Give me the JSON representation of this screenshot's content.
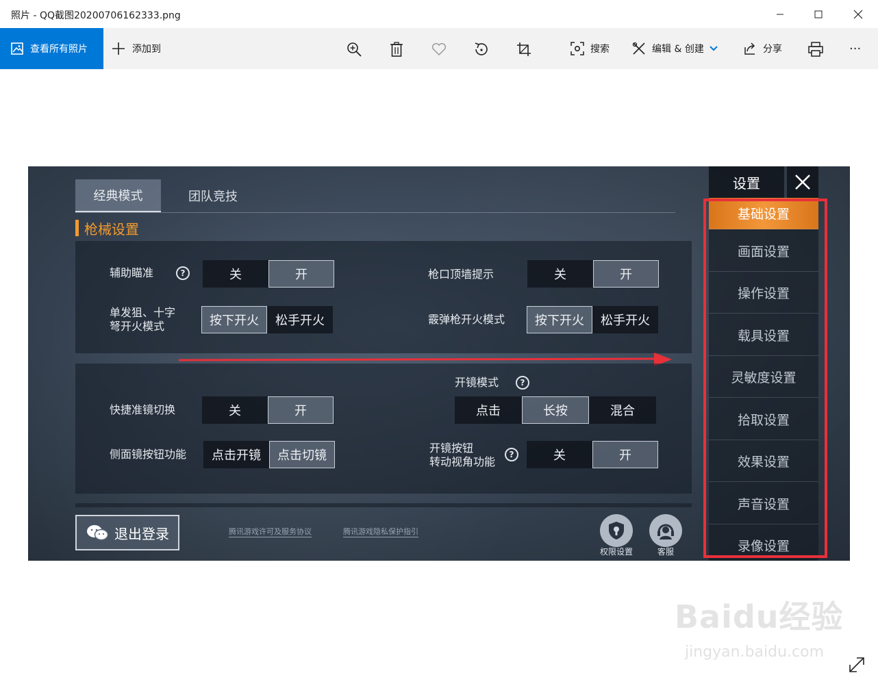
{
  "window": {
    "title": "照片 - QQ截图20200706162333.png"
  },
  "toolbar": {
    "view_all": "查看所有照片",
    "add_to": "添加到",
    "search": "搜索",
    "edit_create": "编辑 & 创建",
    "share": "分享",
    "more": "···"
  },
  "game": {
    "tabs": [
      "经典模式",
      "团队竞技"
    ],
    "section_title": "枪械设置",
    "aim_assist": {
      "label": "辅助瞄准",
      "options": [
        "关",
        "开"
      ],
      "selected": 1
    },
    "muzzle_hint": {
      "label": "枪口顶墙提示",
      "options": [
        "关",
        "开"
      ],
      "selected": 1
    },
    "sniper_fire": {
      "label_line1": "单发狙、十字",
      "label_line2": "弩开火模式",
      "options": [
        "按下开火",
        "松手开火"
      ],
      "selected": 0
    },
    "shotgun_fire": {
      "label": "霰弹枪开火模式",
      "options": [
        "按下开火",
        "松手开火"
      ],
      "selected": 0
    },
    "scope_mode": {
      "label": "开镜模式",
      "options": [
        "点击",
        "长按",
        "混合"
      ],
      "selected": 1
    },
    "quick_scope": {
      "label": "快捷准镜切换",
      "options": [
        "关",
        "开"
      ],
      "selected": 1
    },
    "side_scope": {
      "label": "侧面镜按钮功能",
      "options": [
        "点击开镜",
        "点击切镜"
      ],
      "selected": 1
    },
    "scope_turn": {
      "label_line1": "开镜按钮",
      "label_line2": "转动视角功能",
      "options": [
        "关",
        "开"
      ],
      "selected": 1
    },
    "qmark": "?",
    "logout": "退出登录",
    "links": [
      "腾讯游戏许可及服务协议",
      "腾讯游戏隐私保护指引"
    ],
    "permission": "权限设置",
    "support": "客服",
    "settings_title": "设置",
    "menu": [
      "基础设置",
      "画面设置",
      "操作设置",
      "载具设置",
      "灵敏度设置",
      "拾取设置",
      "效果设置",
      "声音设置",
      "录像设置"
    ],
    "menu_active": 0
  },
  "watermark": {
    "logo": "Baidu经验",
    "sub": "jingyan.baidu.com"
  },
  "colors": {
    "accent": "#0078d7",
    "orange": "#f39a2e",
    "red": "#e8303a"
  }
}
